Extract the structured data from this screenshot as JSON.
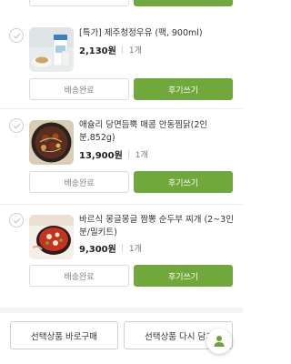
{
  "items": [
    {
      "name": "[특가] 제주청정우유 (팩, 900ml)",
      "price": "2,130원",
      "qty": "1개"
    },
    {
      "name": "애슐리 당면듬뿍 매콤 안동찜닭(2인분,852g)",
      "price": "13,900원",
      "qty": "1개"
    },
    {
      "name": "바르식 몽글몽글 짬뽕 순두부 찌개 (2~3인분/밀키트)",
      "price": "9,300원",
      "qty": "1개"
    }
  ],
  "buttons": {
    "delivered": "배송완료",
    "review": "후기쓰기"
  },
  "bottom_bar": {
    "buy_selected": "선택상품 바로구매",
    "recart_selected": "선택상품 다시 담기"
  },
  "colors": {
    "accent_green": "#70a83c"
  },
  "icons": {
    "check": "check-icon",
    "fab": "person-icon"
  }
}
